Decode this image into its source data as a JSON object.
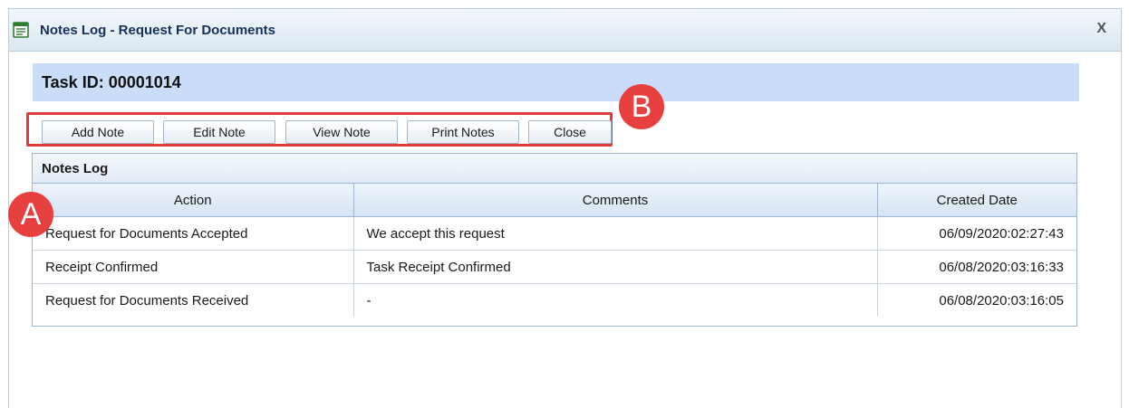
{
  "window": {
    "title": "Notes Log - Request For Documents",
    "close_label": "X"
  },
  "task": {
    "label": "Task ID: 00001014"
  },
  "toolbar": {
    "add_note": "Add Note",
    "edit_note": "Edit Note",
    "view_note": "View Note",
    "print_notes": "Print Notes",
    "close": "Close"
  },
  "annotations": {
    "a": "A",
    "b": "B"
  },
  "grid": {
    "caption": "Notes Log",
    "columns": [
      "Action",
      "Comments",
      "Created Date"
    ],
    "rows": [
      {
        "action": "Request for Documents Accepted",
        "comments": "We accept this request",
        "created": "06/09/2020:02:27:43"
      },
      {
        "action": "Receipt Confirmed",
        "comments": "Task Receipt Confirmed",
        "created": "06/08/2020:03:16:33"
      },
      {
        "action": "Request for Documents Received",
        "comments": "-",
        "created": "06/08/2020:03:16:05"
      }
    ]
  },
  "colors": {
    "annotation_red": "#e03a3a",
    "task_bar": "#c9ddf9"
  },
  "icons": {
    "window_icon": "notes-window-icon"
  }
}
